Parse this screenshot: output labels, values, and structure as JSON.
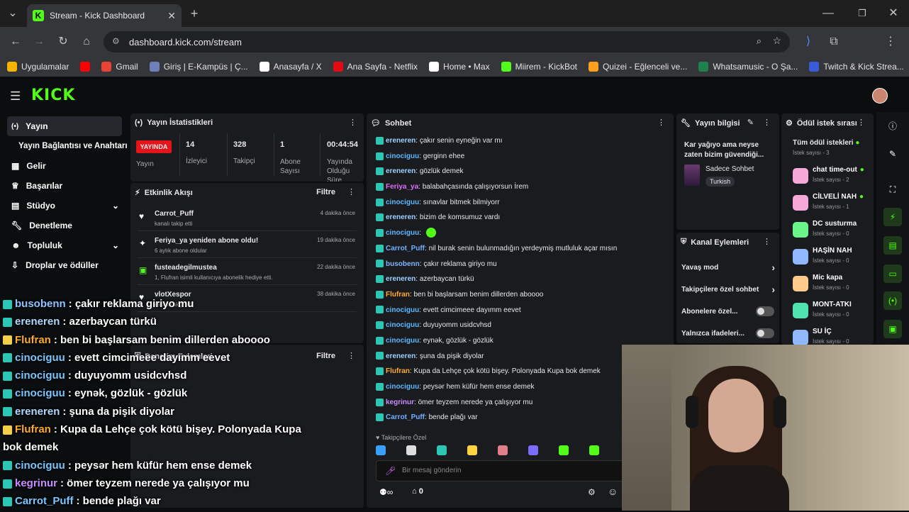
{
  "browser": {
    "tab_title": "Stream - Kick Dashboard",
    "url": "dashboard.kick.com/stream",
    "bookmarks": [
      {
        "label": "Uygulamalar",
        "color": "#f4b400"
      },
      {
        "label": "",
        "color": "#ff0000"
      },
      {
        "label": "Gmail",
        "color": "#ea4335"
      },
      {
        "label": "Giriş | E-Kampüs | Ç...",
        "color": "#6f7fb7"
      },
      {
        "label": "Anasayfa / X",
        "color": "#ffffff"
      },
      {
        "label": "Ana Sayfa - Netflix",
        "color": "#e50914"
      },
      {
        "label": "Home • Max",
        "color": "#ffffff"
      },
      {
        "label": "Miirem - KickBot",
        "color": "#53fc18"
      },
      {
        "label": "Quizei - Eğlenceli ve...",
        "color": "#ff9f1c"
      },
      {
        "label": "Whatsamusic - O Şa...",
        "color": "#1e824c"
      },
      {
        "label": "Twitch & Kick Strea...",
        "color": "#3a5bd9"
      }
    ]
  },
  "nav": {
    "logo": "KICK",
    "items": [
      "Yayın",
      "Yayın Bağlantısı ve Anahtarı",
      "Gelir",
      "Başarılar",
      "Stüdyo",
      "Denetleme",
      "Topluluk",
      "Droplar ve ödüller"
    ]
  },
  "stats": {
    "title": "Yayın İstatistikleri",
    "live": "YAYINDA",
    "live_label": "Yayın",
    "viewers": "14",
    "viewers_label": "İzleyici",
    "followers": "328",
    "followers_label": "Takipçi",
    "subs": "1",
    "subs_label": "Abone Sayısı",
    "uptime": "00:44:54",
    "uptime_label": "Yayında Olduğu Süre"
  },
  "activity": {
    "title": "Etkinlik Akışı",
    "filter": "Filtre",
    "items": [
      {
        "name": "Carrot_Puff",
        "sub": "kanalı takip etti",
        "time": "4 dakika önce"
      },
      {
        "name": "Feriya_ya yeniden abone oldu!",
        "sub": "6 aylık abone oldular",
        "time": "19 dakika önce"
      },
      {
        "name": "fusteadegilmustea",
        "sub": "1, Flufran isimli kullanıcıya abonelik hediye etti.",
        "time": "22 dakika önce"
      },
      {
        "name": "vlotXespor",
        "sub": "kanalı takip etti",
        "time": "38 dakika önce"
      }
    ]
  },
  "mod": {
    "title": "Denetim Eylemleri",
    "filter": "Filtre"
  },
  "chat": {
    "title": "Sohbet",
    "footer_label": "Takipçilere Özel",
    "input_placeholder": "Bir mesaj gönderin",
    "bottom_count": "0",
    "messages": [
      {
        "user": "ereneren",
        "color": "#9ed0ff",
        "text": "çakır senin eyneğin var mı"
      },
      {
        "user": "cinociguu",
        "color": "#5cb8ff",
        "text": "gerginn ehee"
      },
      {
        "user": "ereneren",
        "color": "#9ed0ff",
        "text": "gözlük demek"
      },
      {
        "user": "Feriya_ya",
        "color": "#e06cff",
        "text": "balabahçasında çalışıyorsun İrem"
      },
      {
        "user": "cinociguu",
        "color": "#5cb8ff",
        "text": "sınavlar bitmek bilmiyorr"
      },
      {
        "user": "ereneren",
        "color": "#9ed0ff",
        "text": "bizim de komsumuz vardı"
      },
      {
        "user": "cinociguu",
        "color": "#5cb8ff",
        "text": ""
      },
      {
        "user": "Carrot_Puff",
        "color": "#6fb1ff",
        "text": "nil burak senin bulunmadığın yerdeymiş mutluluk açar mısın"
      },
      {
        "user": "busobenn",
        "color": "#7fb6ff",
        "text": "çakır reklama giriyo mu"
      },
      {
        "user": "ereneren",
        "color": "#9ed0ff",
        "text": "azerbaycan türkü"
      },
      {
        "user": "Flufran",
        "color": "#ffaa33",
        "text": "ben bi başlarsam benim dillerden aboooo"
      },
      {
        "user": "cinociguu",
        "color": "#5cb8ff",
        "text": "evett cimcimeee dayımm eevet"
      },
      {
        "user": "cinociguu",
        "color": "#5cb8ff",
        "text": "duyuyomm usidcvhsd"
      },
      {
        "user": "cinociguu",
        "color": "#5cb8ff",
        "text": "eynək, gözlük - gözlük"
      },
      {
        "user": "ereneren",
        "color": "#9ed0ff",
        "text": "şuna da pişik diyolar"
      },
      {
        "user": "Flufran",
        "color": "#ffaa33",
        "text": "Kupa da Lehçe çok kötü bişey. Polonyada Kupa bok demek"
      },
      {
        "user": "cinociguu",
        "color": "#5cb8ff",
        "text": "peysər hem küfür hem ense demek"
      },
      {
        "user": "kegrinur",
        "color": "#c98cff",
        "text": "ömer teyzem nerede ya çalışıyor mu"
      },
      {
        "user": "Carrot_Puff",
        "color": "#6fb1ff",
        "text": "bende plağı var"
      }
    ]
  },
  "info": {
    "title": "Yayın bilgisi",
    "stream_title": "Kar yağıyo ama neyse zaten bizim güvendiği...",
    "category": "Sadece Sohbet",
    "tag": "Turkish"
  },
  "actions": {
    "title": "Kanal Eylemleri",
    "items": [
      "Yavaş mod",
      "Takipçilere özel sohbet",
      "Abonelere özel...",
      "Yalnızca ifadeleri..."
    ]
  },
  "rewards": {
    "title": "Ödül istek sırası",
    "all": "Tüm ödül istekleri",
    "all_count": "İstek sayısı - 3",
    "items": [
      {
        "name": "chat time-out",
        "count": "İstek sayısı - 2",
        "color": "#f6a9d8",
        "dot": true
      },
      {
        "name": "CİLVELİ NAH",
        "count": "İstek sayısı - 1",
        "color": "#f6a9d8",
        "dot": true
      },
      {
        "name": "DC susturma",
        "count": "İstek sayısı - 0",
        "color": "#6af58a",
        "dot": false
      },
      {
        "name": "HAŞİN NAH",
        "count": "İstek sayısı - 0",
        "color": "#8fb8ff",
        "dot": false
      },
      {
        "name": "Mic kapa",
        "count": "İstek sayısı - 0",
        "color": "#ffc98a",
        "dot": false
      },
      {
        "name": "MONT-ATKI",
        "count": "İstek sayısı - 0",
        "color": "#4fe3b0",
        "dot": false
      },
      {
        "name": "SU İÇ",
        "count": "İstek sayısı - 0",
        "color": "#8fb8ff",
        "dot": false
      }
    ]
  },
  "overlay": {
    "lines": [
      {
        "user": "busobenn",
        "color": "#8fc3ff",
        "text": ": çakır reklama giriyo mu"
      },
      {
        "user": "ereneren",
        "color": "#b0d8ff",
        "text": ": azerbaycan türkü"
      },
      {
        "user": "Flufran",
        "color": "#ffaa33",
        "text": ": ben bi başlarsam benim dillerden aboooo"
      },
      {
        "user": "cinociguu",
        "color": "#7cc6ff",
        "text": ": evett cimcimeee dayımm eevet"
      },
      {
        "user": "cinociguu",
        "color": "#7cc6ff",
        "text": ": duyuyomm usidcvhsd"
      },
      {
        "user": "cinociguu",
        "color": "#7cc6ff",
        "text": ": eynək, gözlük - gözlük"
      },
      {
        "user": "ereneren",
        "color": "#b0d8ff",
        "text": ": şuna da pişik diyolar"
      },
      {
        "user": "Flufran",
        "color": "#ffaa33",
        "text": ": Kupa da Lehçe çok kötü bişey. Polonyada Kupa"
      },
      {
        "user": "",
        "color": "#ffffff",
        "text": "bok demek"
      },
      {
        "user": "cinociguu",
        "color": "#7cc6ff",
        "text": ": peysər hem küfür hem ense demek"
      },
      {
        "user": "kegrinur",
        "color": "#c98cff",
        "text": ": ömer teyzem nerede ya çalışıyor mu"
      },
      {
        "user": "Carrot_Puff",
        "color": "#7cc6ff",
        "text": ": bende plağı var"
      }
    ]
  },
  "colors": {
    "brand": "#53fc18",
    "live": "#e4141b"
  }
}
